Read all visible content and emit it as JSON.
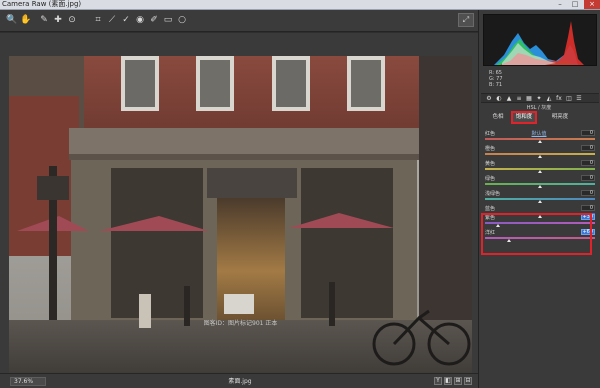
{
  "window": {
    "title": "Camera Raw (素面.jpg)",
    "minimize": "–",
    "maximize": "□",
    "close": "×"
  },
  "toolbar": {
    "tools": [
      {
        "name": "zoom-tool-icon",
        "glyph": "🔍"
      },
      {
        "name": "hand-tool-icon",
        "glyph": "✋"
      },
      {
        "name": "white-balance-tool-icon",
        "glyph": "✎"
      },
      {
        "name": "color-sampler-tool-icon",
        "glyph": "✚"
      },
      {
        "name": "targeted-adjust-tool-icon",
        "glyph": "⊙"
      },
      {
        "name": "crop-tool-icon",
        "glyph": "⌗"
      },
      {
        "name": "straighten-tool-icon",
        "glyph": "⟋"
      },
      {
        "name": "spot-removal-tool-icon",
        "glyph": "✓"
      },
      {
        "name": "red-eye-tool-icon",
        "glyph": "◉"
      },
      {
        "name": "adjustment-brush-icon",
        "glyph": "✐"
      },
      {
        "name": "graduated-filter-icon",
        "glyph": "▭"
      },
      {
        "name": "radial-filter-icon",
        "glyph": "○"
      }
    ],
    "fullscreen_glyph": "⤢"
  },
  "canvas": {
    "watermark": "图客ID：图片标记901 正本"
  },
  "status": {
    "zoom": "37.6%",
    "filename": "素面.jpg",
    "view_btns": [
      "Y",
      "◧",
      "⊞",
      "⊟"
    ]
  },
  "panel": {
    "readout": {
      "r": "R:  65",
      "g": "G:  77",
      "b": "B:  71"
    },
    "tab_icons": [
      "⚙",
      "◐",
      "▲",
      "≡",
      "▦",
      "✦",
      "◭",
      "fx",
      "◫",
      "☰"
    ],
    "section_title": "HSL / 灰度",
    "subtabs": {
      "hue": "色相",
      "saturation": "饱和度",
      "luminance": "明亮度"
    },
    "default_link": "默认值",
    "sliders": [
      {
        "label": "红色",
        "value": "0",
        "thumb": 0.5,
        "color_a": "#c15a5a",
        "color_b": "#c97f4f"
      },
      {
        "label": "橙色",
        "value": "0",
        "thumb": 0.5,
        "color_a": "#c97f4f",
        "color_b": "#c7b14c"
      },
      {
        "label": "黄色",
        "value": "0",
        "thumb": 0.5,
        "color_a": "#c7b14c",
        "color_b": "#7fb24d"
      },
      {
        "label": "绿色",
        "value": "0",
        "thumb": 0.5,
        "color_a": "#6ab04e",
        "color_b": "#4fb0a0"
      },
      {
        "label": "浅绿色",
        "value": "0",
        "thumb": 0.5,
        "color_a": "#4fb0a0",
        "color_b": "#4f88c0"
      },
      {
        "label": "蓝色",
        "value": "0",
        "thumb": 0.5,
        "color_a": "#4f88c0",
        "color_b": "#6a5cc0"
      },
      {
        "label": "紫色",
        "value": "+30",
        "thumb": 0.12,
        "color_a": "#8a5cc0",
        "color_b": "#b35cba"
      },
      {
        "label": "洋红",
        "value": "+60",
        "thumb": 0.22,
        "color_a": "#b35cba",
        "color_b": "#c45a88"
      }
    ]
  }
}
